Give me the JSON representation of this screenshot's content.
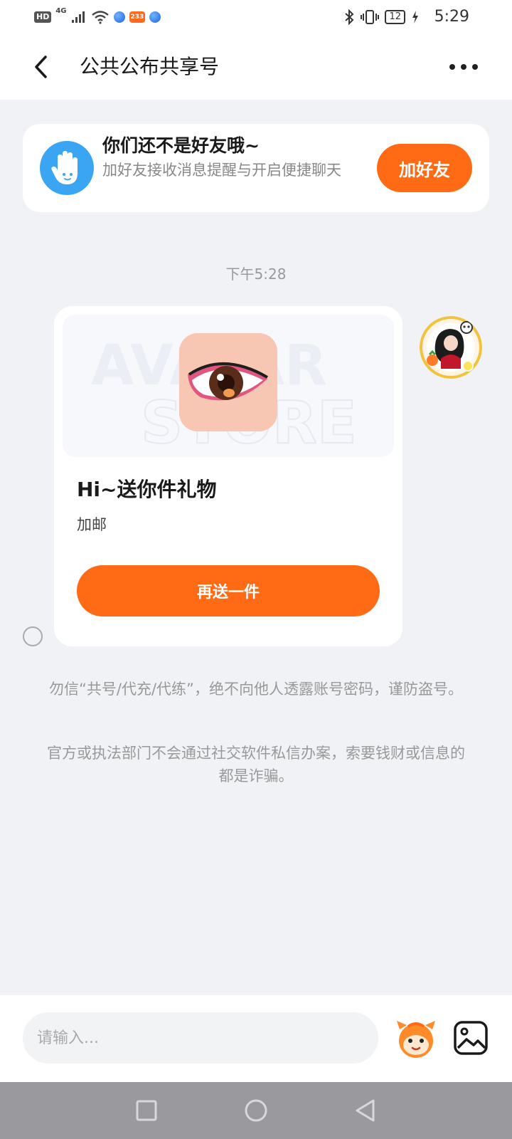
{
  "status_bar": {
    "hd_label": "HD",
    "network_label": "4G",
    "app_badge": "233",
    "battery_level": "12",
    "time": "5:29"
  },
  "header": {
    "title": "公共公布共享号"
  },
  "friend_banner": {
    "title": "你们还不是好友哦~",
    "description": "加好友接收消息提醒与开启便捷聊天",
    "button_label": "加好友"
  },
  "message": {
    "timestamp": "下午5:28",
    "card": {
      "watermark_line1": "AVATAR",
      "watermark_line2": "STORE",
      "title": "Hi~送你件礼物",
      "subtitle": "加邮",
      "button_label": "再送一件"
    }
  },
  "notices": [
    "勿信“共号/代充/代练”，绝不向他人透露账号密码，谨防盗号。",
    "官方或执法部门不会通过社交软件私信办案，索要钱财或信息的都是诈骗。"
  ],
  "input_bar": {
    "placeholder": "请输入..."
  },
  "colors": {
    "accent": "#ff6a14",
    "banner_icon": "#3aa6f3",
    "background": "#f0f2f5"
  },
  "icons": {
    "back": "back-arrow-icon",
    "more": "more-dots-icon",
    "hand": "hand-wave-icon",
    "emoji": "emoji-mascot-icon",
    "image": "image-icon"
  }
}
